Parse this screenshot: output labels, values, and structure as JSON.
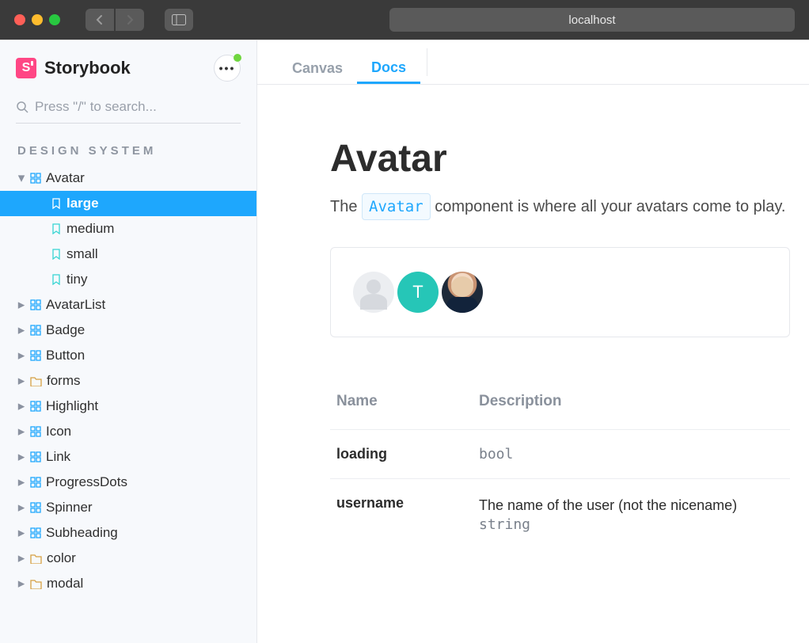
{
  "window": {
    "address": "localhost"
  },
  "brand": {
    "name": "Storybook",
    "logo_letter": "S"
  },
  "search": {
    "placeholder": "Press \"/\" to search..."
  },
  "sidebar": {
    "section": "DESIGN SYSTEM",
    "items": [
      {
        "label": "Avatar",
        "type": "component",
        "expanded": true,
        "children": [
          {
            "label": "large",
            "selected": true
          },
          {
            "label": "medium"
          },
          {
            "label": "small"
          },
          {
            "label": "tiny"
          }
        ]
      },
      {
        "label": "AvatarList",
        "type": "component"
      },
      {
        "label": "Badge",
        "type": "component"
      },
      {
        "label": "Button",
        "type": "component"
      },
      {
        "label": "forms",
        "type": "folder"
      },
      {
        "label": "Highlight",
        "type": "component"
      },
      {
        "label": "Icon",
        "type": "component"
      },
      {
        "label": "Link",
        "type": "component"
      },
      {
        "label": "ProgressDots",
        "type": "component"
      },
      {
        "label": "Spinner",
        "type": "component"
      },
      {
        "label": "Subheading",
        "type": "component"
      },
      {
        "label": "color",
        "type": "folder"
      },
      {
        "label": "modal",
        "type": "folder"
      }
    ]
  },
  "tabs": [
    {
      "label": "Canvas",
      "active": false
    },
    {
      "label": "Docs",
      "active": true
    }
  ],
  "doc": {
    "title": "Avatar",
    "sub_prefix": "The ",
    "sub_code": "Avatar",
    "sub_suffix": " component is where all your avatars come to play.",
    "preview_initial": "T",
    "props_headers": {
      "name": "Name",
      "desc": "Description"
    },
    "props": [
      {
        "name": "loading",
        "desc": "",
        "type": "bool"
      },
      {
        "name": "username",
        "desc": "The name of the user (not the nicename)",
        "type": "string"
      }
    ]
  }
}
